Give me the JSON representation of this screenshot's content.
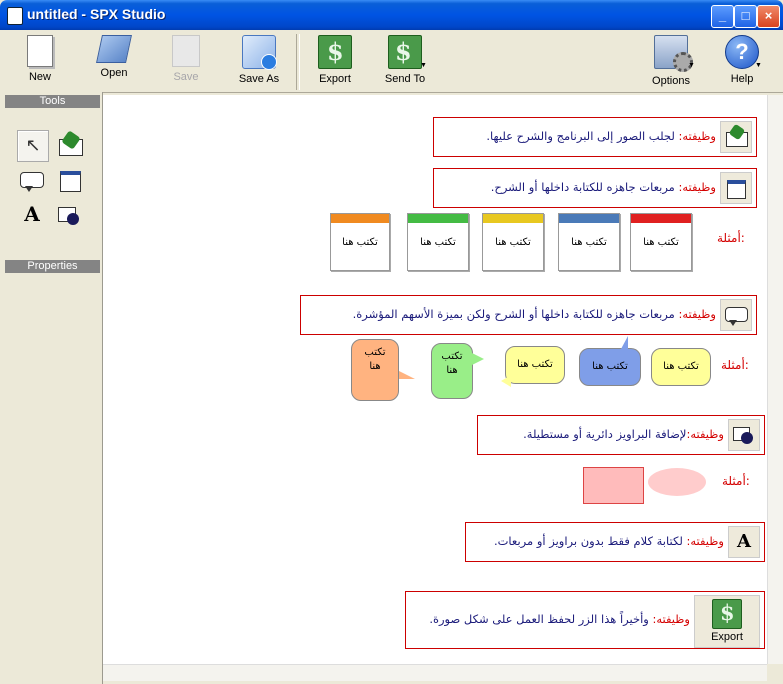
{
  "window": {
    "title": "untitled - SPX Studio",
    "min": "_",
    "max": "□",
    "close": "×"
  },
  "toolbar": {
    "new": "New",
    "open": "Open",
    "save": "Save",
    "save_as": "Save As",
    "export": "Export",
    "send_to": "Send To",
    "options": "Options",
    "help": "Help"
  },
  "panel": {
    "tools": "Tools",
    "properties": "Properties"
  },
  "canvas": {
    "rows": [
      {
        "label": "وظيفته:",
        "text": " لجلب الصور إلى البرنامج والشرح عليها."
      },
      {
        "label": "وظيفته:",
        "text": " مربعات جاهزه للكتابة داخلها أو الشرح."
      },
      {
        "label": "وظيفته:",
        "text": " مربعات جاهزه للكتابة داخلها أو الشرح ولكن بميزة الأسهم المؤشرة."
      },
      {
        "label": "وظيفته:",
        "text": "لإضافة البراويز دائرية أو مستطيلة."
      },
      {
        "label": "وظيفته:",
        "text": " لكتابة كلام فقط بدون براويز أو مربعات."
      },
      {
        "label": "وظيفته:",
        "text": " وأخيراً هذا الزر لحفظ العمل على شكل صورة."
      }
    ],
    "examples_label": "أمثلة:",
    "note_text": "تكتب هنا",
    "bubble_text_wrapped": "تكتب\nهنا",
    "text_tool_letter": "A",
    "export_label": "Export"
  },
  "colors": {
    "title_bar": "#0054e3",
    "highlight_border": "#cc0000",
    "label_red": "#d40000",
    "text_navy": "#1a1a7a",
    "note_red": "#e02020",
    "note_blue": "#4a7ab8",
    "note_yellow": "#e8c820",
    "note_green": "#44bb44",
    "note_orange": "#f08a20"
  }
}
